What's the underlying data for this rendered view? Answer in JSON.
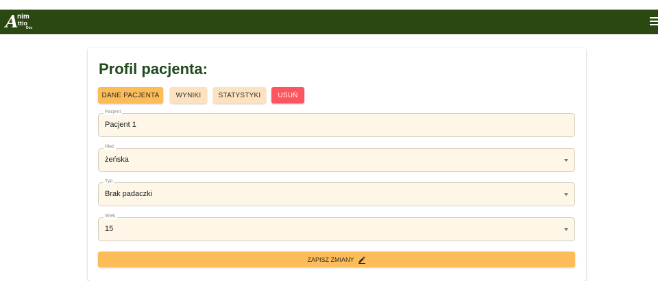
{
  "header": {
    "logo": {
      "big": "A",
      "line1": "nim",
      "line2": "ttio",
      "line3": "Doc"
    },
    "menu_icon": "hamburger-menu-icon",
    "background": "#2b4712"
  },
  "page": {
    "title": "Profil pacjenta:"
  },
  "tabs": {
    "dane": "DANE PACJENTA",
    "wyniki": "WYNIKI",
    "statystyki": "STATYSTYKI",
    "usun": "USUŃ"
  },
  "form": {
    "patient": {
      "label": "Pacjent",
      "value": "Pacjent 1"
    },
    "sex": {
      "label": "Płeć",
      "value": "żeńska"
    },
    "type": {
      "label": "Typ",
      "value": "Brak padaczki"
    },
    "age": {
      "label": "Wiek",
      "value": "15"
    }
  },
  "actions": {
    "save_label": "ZAPISZ ZMIANY",
    "save_icon": "pencil-edit-icon"
  },
  "colors": {
    "accent": "#fcbd58",
    "tab_inactive": "#fde2bf",
    "danger": "#fd5560",
    "title": "#1f4a1c",
    "field_bg": "#fef6e7"
  }
}
